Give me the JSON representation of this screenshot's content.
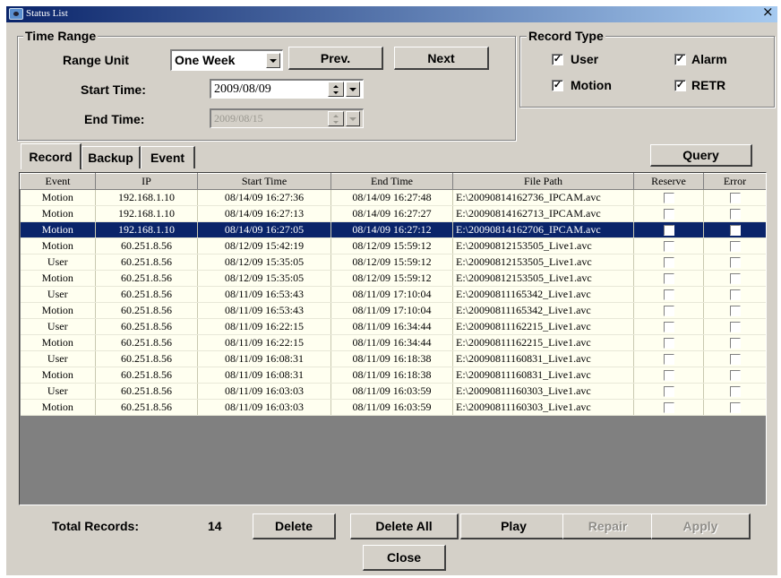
{
  "window": {
    "title": "Status List",
    "close_glyph": "×"
  },
  "time_range": {
    "legend": "Time Range",
    "range_unit_label": "Range Unit",
    "range_unit_value": "One Week",
    "prev_label": "Prev.",
    "next_label": "Next",
    "start_time_label": "Start Time:",
    "start_time_value": "2009/08/09",
    "end_time_label": "End Time:",
    "end_time_value": "2009/08/15"
  },
  "record_type": {
    "legend": "Record Type",
    "options": [
      {
        "label": "User",
        "checked": true
      },
      {
        "label": "Alarm",
        "checked": true
      },
      {
        "label": "Motion",
        "checked": true
      },
      {
        "label": "RETR",
        "checked": true
      }
    ]
  },
  "tabs": [
    {
      "label": "Record",
      "active": true
    },
    {
      "label": "Backup",
      "active": false
    },
    {
      "label": "Event",
      "active": false
    }
  ],
  "query_label": "Query",
  "table": {
    "columns": [
      "Event",
      "IP",
      "Start Time",
      "End Time",
      "File Path",
      "Reserve",
      "Error"
    ],
    "rows": [
      {
        "event": "Motion",
        "ip": "192.168.1.10",
        "start": "08/14/09 16:27:36",
        "end": "08/14/09 16:27:48",
        "path": "E:\\20090814162736_IPCAM.avc",
        "selected": false
      },
      {
        "event": "Motion",
        "ip": "192.168.1.10",
        "start": "08/14/09 16:27:13",
        "end": "08/14/09 16:27:27",
        "path": "E:\\20090814162713_IPCAM.avc",
        "selected": false
      },
      {
        "event": "Motion",
        "ip": "192.168.1.10",
        "start": "08/14/09 16:27:05",
        "end": "08/14/09 16:27:12",
        "path": "E:\\20090814162706_IPCAM.avc",
        "selected": true
      },
      {
        "event": "Motion",
        "ip": "60.251.8.56",
        "start": "08/12/09 15:42:19",
        "end": "08/12/09 15:59:12",
        "path": "E:\\20090812153505_Live1.avc",
        "selected": false
      },
      {
        "event": "User",
        "ip": "60.251.8.56",
        "start": "08/12/09 15:35:05",
        "end": "08/12/09 15:59:12",
        "path": "E:\\20090812153505_Live1.avc",
        "selected": false
      },
      {
        "event": "Motion",
        "ip": "60.251.8.56",
        "start": "08/12/09 15:35:05",
        "end": "08/12/09 15:59:12",
        "path": "E:\\20090812153505_Live1.avc",
        "selected": false
      },
      {
        "event": "User",
        "ip": "60.251.8.56",
        "start": "08/11/09 16:53:43",
        "end": "08/11/09 17:10:04",
        "path": "E:\\20090811165342_Live1.avc",
        "selected": false
      },
      {
        "event": "Motion",
        "ip": "60.251.8.56",
        "start": "08/11/09 16:53:43",
        "end": "08/11/09 17:10:04",
        "path": "E:\\20090811165342_Live1.avc",
        "selected": false
      },
      {
        "event": "User",
        "ip": "60.251.8.56",
        "start": "08/11/09 16:22:15",
        "end": "08/11/09 16:34:44",
        "path": "E:\\20090811162215_Live1.avc",
        "selected": false
      },
      {
        "event": "Motion",
        "ip": "60.251.8.56",
        "start": "08/11/09 16:22:15",
        "end": "08/11/09 16:34:44",
        "path": "E:\\20090811162215_Live1.avc",
        "selected": false
      },
      {
        "event": "User",
        "ip": "60.251.8.56",
        "start": "08/11/09 16:08:31",
        "end": "08/11/09 16:18:38",
        "path": "E:\\20090811160831_Live1.avc",
        "selected": false
      },
      {
        "event": "Motion",
        "ip": "60.251.8.56",
        "start": "08/11/09 16:08:31",
        "end": "08/11/09 16:18:38",
        "path": "E:\\20090811160831_Live1.avc",
        "selected": false
      },
      {
        "event": "User",
        "ip": "60.251.8.56",
        "start": "08/11/09 16:03:03",
        "end": "08/11/09 16:03:59",
        "path": "E:\\20090811160303_Live1.avc",
        "selected": false
      },
      {
        "event": "Motion",
        "ip": "60.251.8.56",
        "start": "08/11/09 16:03:03",
        "end": "08/11/09 16:03:59",
        "path": "E:\\20090811160303_Live1.avc",
        "selected": false
      }
    ]
  },
  "footer": {
    "total_label": "Total Records:",
    "total_value": "14",
    "delete_label": "Delete",
    "delete_all_label": "Delete All",
    "play_label": "Play",
    "repair_label": "Repair",
    "apply_label": "Apply",
    "close_label": "Close"
  },
  "colors": {
    "title_bar": "#0a246a",
    "selection": "#0a246a",
    "row_background": "#fffff0",
    "window_face": "#d4d0c8"
  }
}
